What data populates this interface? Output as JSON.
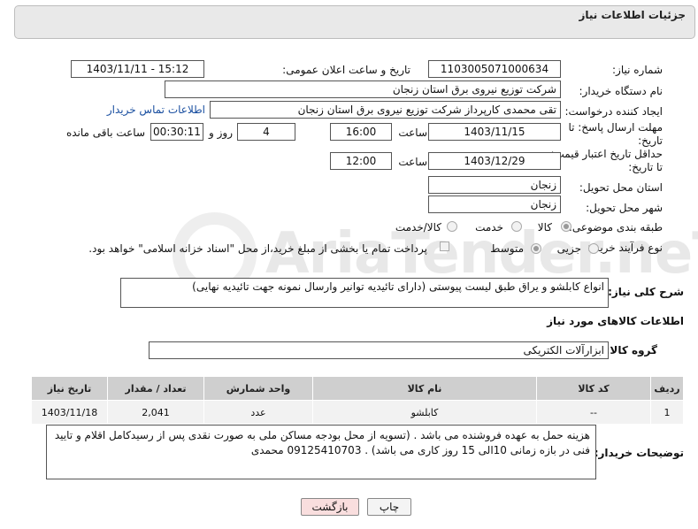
{
  "header": {
    "title": "جزئیات اطلاعات نیاز"
  },
  "fields": {
    "need_number_label": "شماره نیاز:",
    "need_number": "1103005071000634",
    "announce_label": "تاریخ و ساعت اعلان عمومی:",
    "announce_value": "1403/11/11 - 15:12",
    "buyer_org_label": "نام دستگاه خریدار:",
    "buyer_org": "شرکت توزیع نیروی برق استان زنجان",
    "creator_label": "ایجاد کننده درخواست:",
    "creator": "تقی محمدی کارپرداز شرکت توزیع نیروی برق استان زنجان",
    "contact_link": "اطلاعات تماس خریدار",
    "deadline_label": "مهلت ارسال پاسخ: تا تاریخ:",
    "deadline_date": "1403/11/15",
    "time_label": "ساعت",
    "deadline_time": "16:00",
    "days_value": "4",
    "days_label": "روز و",
    "remaining_time": "00:30:11",
    "remaining_label": "ساعت باقی مانده",
    "validity_label": "حداقل تاریخ اعتبار قیمت: تا تاریخ:",
    "validity_date": "1403/12/29",
    "validity_time": "12:00",
    "province_label": "استان محل تحویل:",
    "province": "زنجان",
    "city_label": "شهر محل تحویل:",
    "city": "زنجان",
    "category_label": "طبقه بندی موضوعی:",
    "category_options": [
      "کالا",
      "خدمت",
      "کالا/خدمت"
    ],
    "process_label": "نوع فرآیند خرید :",
    "process_options": [
      "جزیی",
      "متوسط"
    ],
    "payment_note": "پرداخت تمام یا بخشی از مبلغ خرید،از محل \"اسناد خزانه اسلامی\" خواهد بود.",
    "summary_label": "شرح کلی نیاز:",
    "summary": "انواع کابلشو و یراق طبق لیست پیوستی (دارای تائیدیه توانیر وارسال نمونه جهت تائیدیه نهایی)"
  },
  "goods_section": {
    "title": "اطلاعات کالاهای مورد نیاز",
    "group_label": "گروه کالا:",
    "group_value": "ابزارآلات الکتریکی"
  },
  "table": {
    "headers": [
      "ردیف",
      "کد کالا",
      "نام کالا",
      "واحد شمارش",
      "تعداد / مقدار",
      "تاریخ نیاز"
    ],
    "rows": [
      [
        "1",
        "--",
        "کابلشو",
        "عدد",
        "2,041",
        "1403/11/18"
      ]
    ]
  },
  "notes": {
    "label": "توضیحات خریدار:",
    "text": "هزینه حمل به عهده فروشنده می باشد . (تسویه از محل بودجه مساکن ملی به صورت نقدی پس از رسیدکامل اقلام و تایید فنی در بازه زمانی 10الی 15 روز کاری می باشد) . 09125410703 محمدی"
  },
  "buttons": {
    "print": "چاپ",
    "back": "بازگشت"
  },
  "watermark": "AriaTender.neT",
  "colors": {
    "link": "#1a4fa0",
    "table_header": "#cfcfcf",
    "back_button": "#f9dede"
  }
}
